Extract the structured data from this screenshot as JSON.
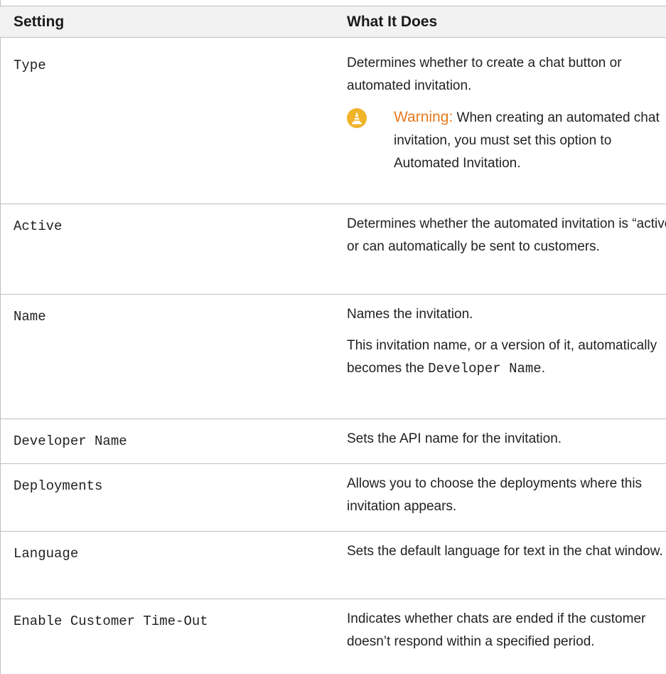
{
  "header": {
    "setting": "Setting",
    "what_it_does": "What It Does"
  },
  "rows": [
    {
      "setting": "Type",
      "desc": "Determines whether to create a chat button or automated invitation.",
      "warning": {
        "label": "Warning:",
        "text": "When creating an automated chat invitation, you must set this option to Automated Invitation.",
        "icon": "warning-cone-icon",
        "color": "#e8791e"
      }
    },
    {
      "setting": "Active",
      "desc": "Determines whether the automated invitation is “active” or can automatically be sent to customers."
    },
    {
      "setting": "Name",
      "desc": "Names the invitation.",
      "desc2_before": "This invitation name, or a version of it, automatically becomes the ",
      "desc2_code": "Developer Name",
      "desc2_after": "."
    },
    {
      "setting": "Developer Name",
      "desc": "Sets the API name for the invitation."
    },
    {
      "setting": "Deployments",
      "desc": "Allows you to choose the deployments where this invitation appears."
    },
    {
      "setting": "Language",
      "desc": "Sets the default language for text in the chat window."
    },
    {
      "setting": "Enable Customer Time-Out",
      "desc": "Indicates whether chats are ended if the customer doesn’t respond within a specified period."
    }
  ]
}
